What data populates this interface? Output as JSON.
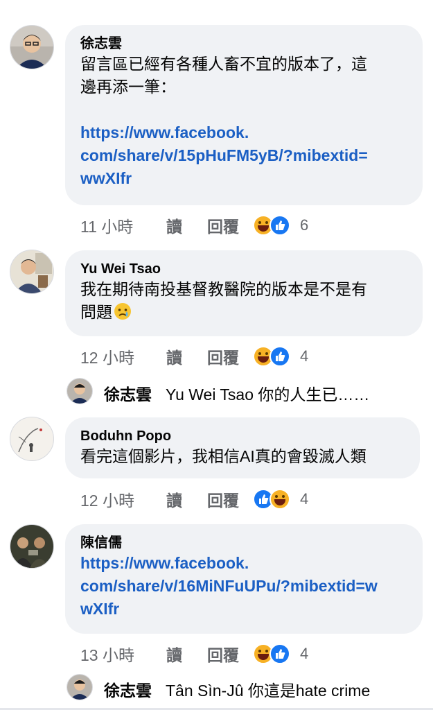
{
  "comments": [
    {
      "author": "徐志雲",
      "text": "留言區已經有各種人畜不宜的版本了，這\n邊再添一筆：",
      "link": "https://www.facebook.\ncom/share/v/15pHuFM5yB/?mibextid=\nwwXIfr",
      "time": "11 小時",
      "read_label": "讀",
      "reply_label": "回覆",
      "reaction_count": "6"
    },
    {
      "author": "Yu Wei Tsao",
      "text": "我在期待南投基督教醫院的版本是不是有\n問題",
      "time": "12 小時",
      "read_label": "讀",
      "reply_label": "回覆",
      "reaction_count": "4",
      "reply": {
        "author": "徐志雲",
        "text": "Yu Wei Tsao 你的人生已……"
      }
    },
    {
      "author": "Boduhn Popo",
      "text": "看完這個影片，我相信AI真的會毀滅人類",
      "time": "12 小時",
      "read_label": "讀",
      "reply_label": "回覆",
      "reaction_count": "4"
    },
    {
      "author": "陳信儒",
      "link": "https://www.facebook.\ncom/share/v/16MiNFuUPu/?mibextid=w\nwXIfr",
      "time": "13 小時",
      "read_label": "讀",
      "reply_label": "回覆",
      "reaction_count": "4",
      "reply": {
        "author": "徐志雲",
        "text": "Tân Sìn-Jû 你這是hate crime"
      }
    }
  ],
  "icons": {
    "haha": "haha-reaction-icon",
    "like": "like-reaction-icon",
    "tear": "crying-face-emoji"
  },
  "colors": {
    "bubble": "#f0f2f5",
    "link": "#1b5fc4",
    "meta": "#65676b",
    "like": "#1877f2",
    "haha": "#f7b125"
  }
}
